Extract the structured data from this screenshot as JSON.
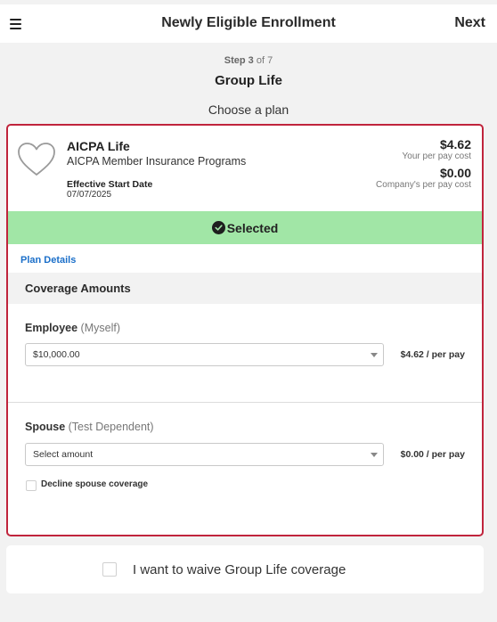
{
  "header": {
    "menu_icon": "hamburger-menu-icon",
    "title": "Newly Eligible Enrollment",
    "next_label": "Next"
  },
  "progress": {
    "step_word": "Step",
    "current_step": "3",
    "of_total": "of 7"
  },
  "section_title": "Group Life",
  "choose_label": "Choose a plan",
  "plan": {
    "icon": "heart-icon",
    "name": "AICPA Life",
    "provider": "AICPA Member Insurance Programs",
    "effective_label": "Effective Start Date",
    "effective_date": "07/07/2025",
    "your_cost": "$4.62",
    "your_cost_label": "Your per pay cost",
    "company_cost": "$0.00",
    "company_cost_label": "Company's per pay cost",
    "selected_label": "Selected",
    "selected_icon": "check-circle-icon",
    "details_link": "Plan Details",
    "accent_color": "#c0243c",
    "selected_color": "#a1e6a6"
  },
  "coverage": {
    "heading": "Coverage Amounts",
    "employee": {
      "label": "Employee",
      "sub": "(Myself)",
      "selected_value": "$10,000.00",
      "per_pay": "$4.62 / per pay"
    },
    "spouse": {
      "label": "Spouse",
      "sub": "(Test Dependent)",
      "selected_value": "Select amount",
      "per_pay": "$0.00 / per pay",
      "decline_label": "Decline spouse coverage"
    }
  },
  "waive": {
    "label": "I want to waive Group Life coverage"
  }
}
